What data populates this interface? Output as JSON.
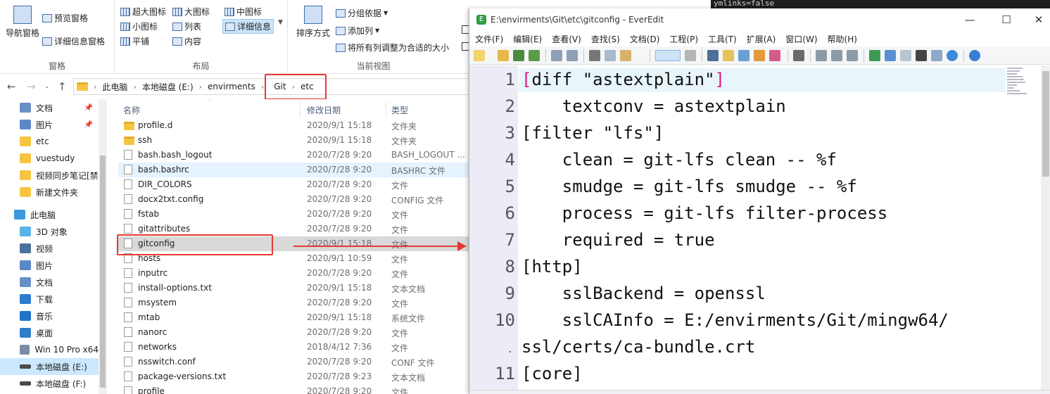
{
  "ribbon": {
    "pane": {
      "nav_pane": "导航窗格",
      "preview_pane": "预览窗格",
      "details_pane": "详细信息窗格",
      "group_label": "窗格"
    },
    "layout": {
      "items": [
        "超大图标",
        "大图标",
        "中图标",
        "小图标",
        "列表",
        "详细信息",
        "平铺",
        "内容"
      ],
      "group_label": "布局"
    },
    "view": {
      "sort_by": "排序方式",
      "group_by": "分组依据",
      "add_column": "添加列",
      "fit_columns": "将所有列调整为合适的大小",
      "group_label": "当前视图"
    }
  },
  "address": {
    "crumbs": [
      "此电脑",
      "本地磁盘 (E:)",
      "envirments",
      "Git",
      "etc"
    ]
  },
  "sidebar": {
    "items": [
      {
        "label": "文档",
        "icon": "documents-icon",
        "pinned": true
      },
      {
        "label": "图片",
        "icon": "pictures-icon",
        "pinned": true
      },
      {
        "label": "etc",
        "icon": "folder-icon"
      },
      {
        "label": "vuestudy",
        "icon": "folder-icon"
      },
      {
        "label": "视频同步笔记[禁",
        "icon": "folder-icon"
      },
      {
        "label": "新建文件夹",
        "icon": "folder-icon"
      },
      {
        "label": "此电脑",
        "icon": "this-pc-icon"
      },
      {
        "label": "3D 对象",
        "icon": "3d-objects-icon"
      },
      {
        "label": "视频",
        "icon": "videos-icon"
      },
      {
        "label": "图片",
        "icon": "pictures-icon"
      },
      {
        "label": "文档",
        "icon": "documents-icon"
      },
      {
        "label": "下载",
        "icon": "downloads-icon"
      },
      {
        "label": "音乐",
        "icon": "music-icon"
      },
      {
        "label": "桌面",
        "icon": "desktop-icon"
      },
      {
        "label": "Win 10 Pro x64",
        "icon": "drive-icon"
      },
      {
        "label": "本地磁盘 (E:)",
        "icon": "drive-icon"
      },
      {
        "label": "本地磁盘 (F:)",
        "icon": "drive-icon"
      }
    ]
  },
  "filelist": {
    "columns": {
      "name": "名称",
      "date": "修改日期",
      "type": "类型"
    },
    "rows": [
      {
        "name": "profile.d",
        "date": "2020/9/1 15:18",
        "type": "文件夹",
        "folder": true
      },
      {
        "name": "ssh",
        "date": "2020/9/1 15:18",
        "type": "文件夹",
        "folder": true
      },
      {
        "name": "bash.bash_logout",
        "date": "2020/7/28 9:20",
        "type": "BASH_LOGOUT ..."
      },
      {
        "name": "bash.bashrc",
        "date": "2020/7/28 9:20",
        "type": "BASHRC 文件"
      },
      {
        "name": "DIR_COLORS",
        "date": "2020/7/28 9:20",
        "type": "文件"
      },
      {
        "name": "docx2txt.config",
        "date": "2020/7/28 9:20",
        "type": "CONFIG 文件"
      },
      {
        "name": "fstab",
        "date": "2020/7/28 9:20",
        "type": "文件"
      },
      {
        "name": "gitattributes",
        "date": "2020/7/28 9:20",
        "type": "文件"
      },
      {
        "name": "gitconfig",
        "date": "2020/9/1 15:18",
        "type": "文件"
      },
      {
        "name": "hosts",
        "date": "2020/9/1 10:59",
        "type": "文件"
      },
      {
        "name": "inputrc",
        "date": "2020/7/28 9:20",
        "type": "文件"
      },
      {
        "name": "install-options.txt",
        "date": "2020/9/1 15:18",
        "type": "文本文档"
      },
      {
        "name": "msystem",
        "date": "2020/7/28 9:20",
        "type": "文件"
      },
      {
        "name": "mtab",
        "date": "2020/9/1 15:18",
        "type": "系统文件"
      },
      {
        "name": "nanorc",
        "date": "2020/7/28 9:20",
        "type": "文件"
      },
      {
        "name": "networks",
        "date": "2018/4/12 7:36",
        "type": "文件"
      },
      {
        "name": "nsswitch.conf",
        "date": "2020/7/28 9:20",
        "type": "CONF 文件"
      },
      {
        "name": "package-versions.txt",
        "date": "2020/7/28 9:23",
        "type": "文本文档"
      },
      {
        "name": "profile",
        "date": "2020/7/28 9:20",
        "type": "文件"
      }
    ]
  },
  "editor": {
    "title": "E:\\envirments\\Git\\etc\\gitconfig - EverEdit",
    "app_icon_letter": "E",
    "menu": [
      "文件(F)",
      "编辑(E)",
      "查看(V)",
      "查找(S)",
      "文档(D)",
      "工程(P)",
      "工具(T)",
      "扩展(A)",
      "窗口(W)",
      "帮助(H)"
    ],
    "lines": [
      {
        "num": "1",
        "open": "[",
        "text": "diff \"astextplain\"",
        "close": "]"
      },
      {
        "num": "2",
        "text": "    textconv = astextplain"
      },
      {
        "num": "3",
        "text": "[filter \"lfs\"]"
      },
      {
        "num": "4",
        "text": "    clean = git-lfs clean -- %f"
      },
      {
        "num": "5",
        "text": "    smudge = git-lfs smudge -- %f"
      },
      {
        "num": "6",
        "text": "    process = git-lfs filter-process"
      },
      {
        "num": "7",
        "text": "    required = true"
      },
      {
        "num": "8",
        "text": "[http]"
      },
      {
        "num": "9",
        "text": "    sslBackend = openssl"
      },
      {
        "num": "10",
        "text": "    sslCAInfo = E:/envirments/Git/mingw64/"
      },
      {
        "num": ".",
        "text": "ssl/certs/ca-bundle.crt",
        "wrap": true
      },
      {
        "num": "11",
        "text": "[core]"
      }
    ]
  },
  "terminal": {
    "text": "ymlinks=false"
  },
  "colors": {
    "accent": "#0078d7",
    "annotation_red": "#e53935",
    "bracket": "#e0197d",
    "gutter": "#ececf6"
  }
}
